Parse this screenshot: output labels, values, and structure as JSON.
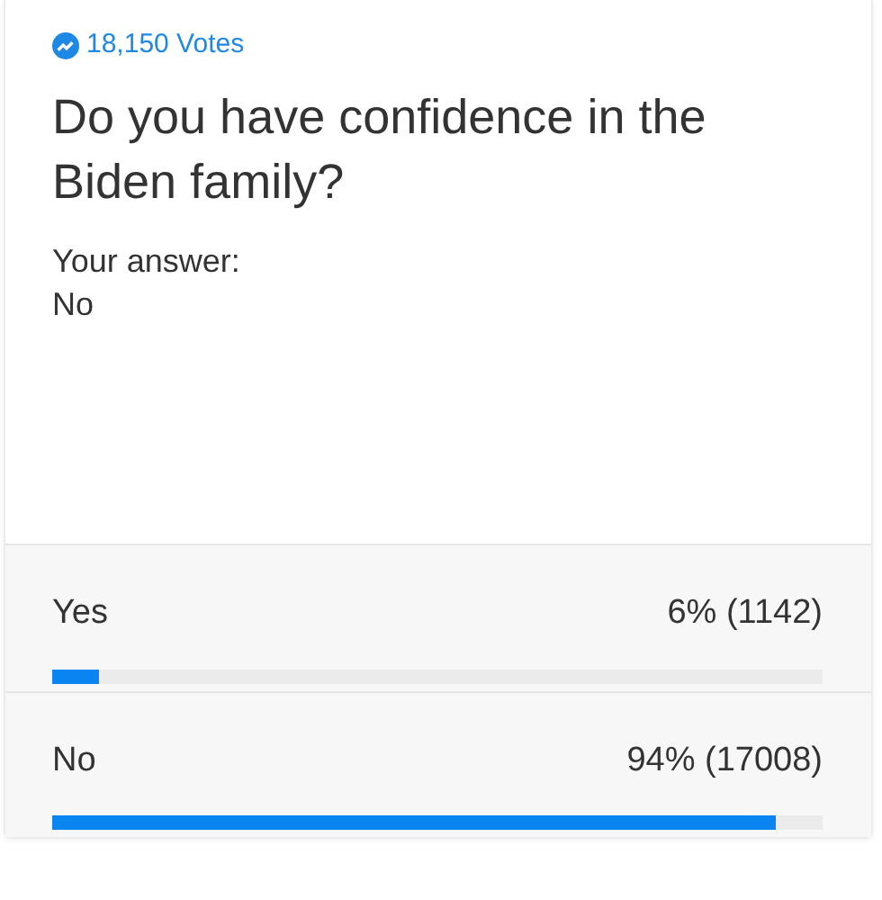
{
  "poll": {
    "votes": "18,150 Votes",
    "question": "Do you have confidence in the Biden family?",
    "answer_label": "Your answer:",
    "answer": "No"
  },
  "options": [
    {
      "label": "Yes",
      "result": "6% (1142)",
      "level": 0.06
    },
    {
      "label": "No",
      "result": "94% (17008)",
      "level": 0.94
    }
  ]
}
